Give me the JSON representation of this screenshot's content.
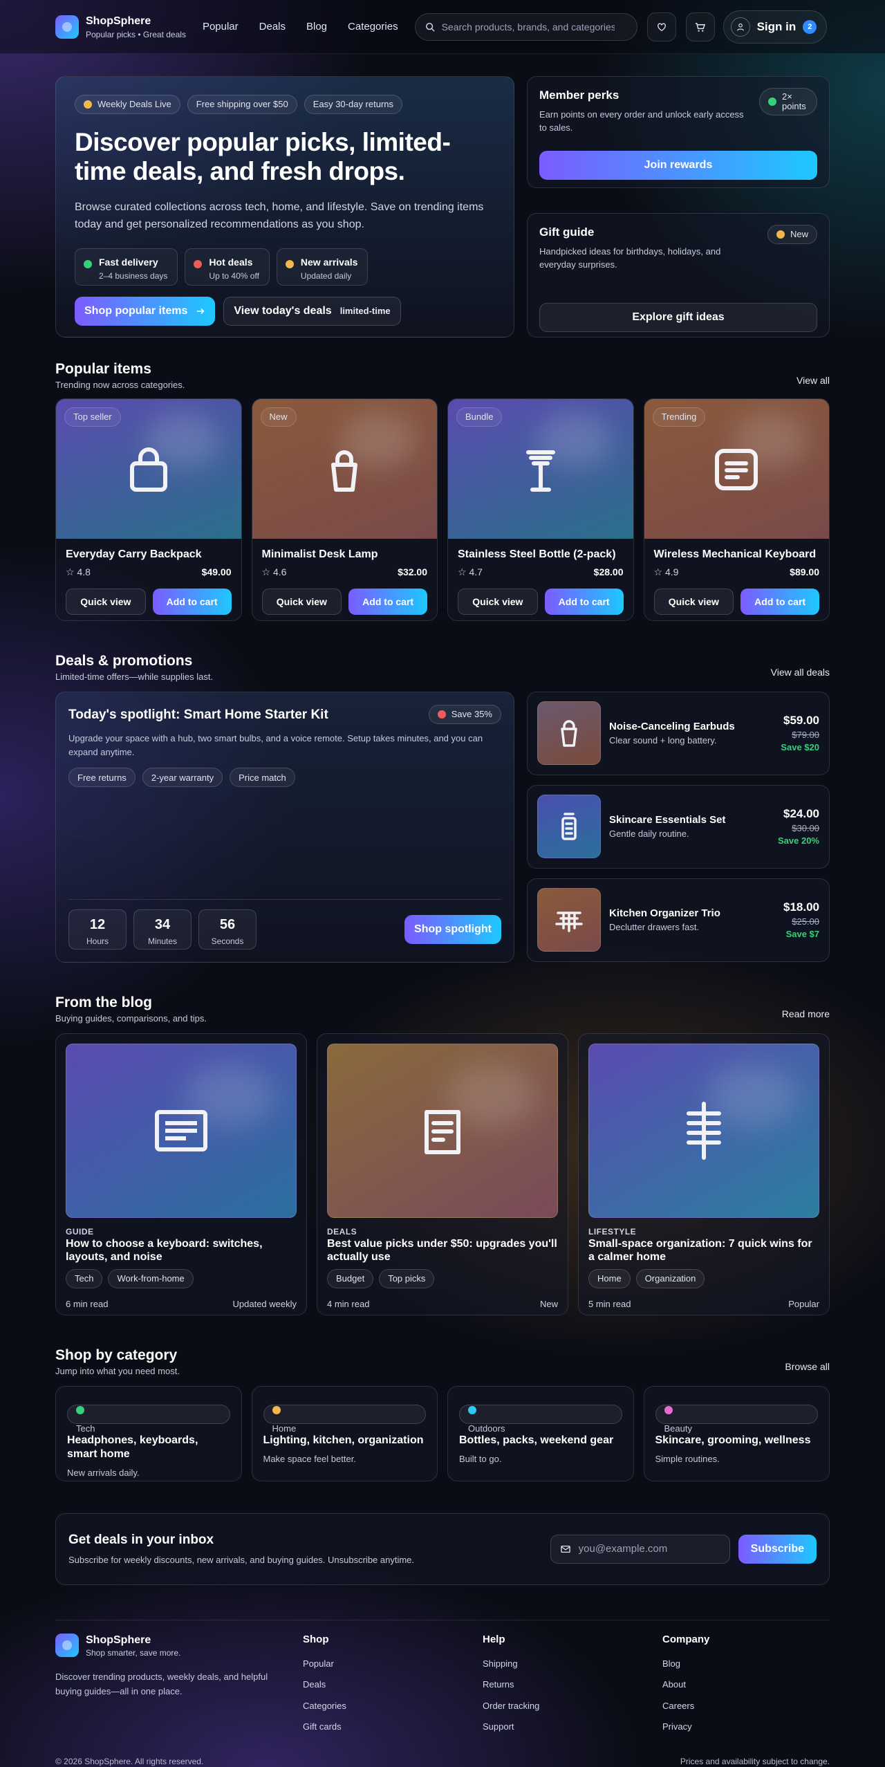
{
  "header": {
    "brand": "ShopSphere",
    "tagline": "Popular picks • Great deals",
    "nav": [
      "Popular",
      "Deals",
      "Blog",
      "Categories"
    ],
    "search_placeholder": "Search products, brands, and categories",
    "signin_label": "Sign in",
    "cart_count": "2"
  },
  "hero": {
    "pills": [
      "Weekly Deals Live",
      "Free shipping over $50",
      "Easy 30-day returns"
    ],
    "title": "Discover popular picks, limited-time deals, and fresh drops.",
    "text": "Browse curated collections across tech, home, and lifestyle. Save on trending items today and get personalized recommendations as you shop.",
    "features": [
      {
        "title": "Fast delivery",
        "sub": "2–4 business days",
        "color": "#34d17a"
      },
      {
        "title": "Hot deals",
        "sub": "Up to 40% off",
        "color": "#ef5b5b"
      },
      {
        "title": "New arrivals",
        "sub": "Updated daily",
        "color": "#f2b84b"
      }
    ],
    "cta_primary": "Shop popular items",
    "cta_secondary": "View today's deals",
    "cta_secondary_tag": "limited-time"
  },
  "perks": {
    "title": "Member perks",
    "text": "Earn points on every order and unlock early access to sales.",
    "badge": "2× points",
    "button": "Join rewards"
  },
  "gift": {
    "title": "Gift guide",
    "text": "Handpicked ideas for birthdays, holidays, and everyday surprises.",
    "badge": "New",
    "button": "Explore gift ideas"
  },
  "popular": {
    "title": "Popular items",
    "subtitle": "Trending now across categories.",
    "link": "View all",
    "quick_view": "Quick view",
    "add_to_cart": "Add to cart",
    "items": [
      {
        "badge": "Top seller",
        "name": "Everyday Carry Backpack",
        "rating": "4.8",
        "price": "$49.00",
        "icon": "bag-icon"
      },
      {
        "badge": "New",
        "name": "Minimalist Desk Lamp",
        "rating": "4.6",
        "price": "$32.00",
        "icon": "lamp-icon"
      },
      {
        "badge": "Bundle",
        "name": "Stainless Steel Bottle (2-pack)",
        "rating": "4.7",
        "price": "$28.00",
        "icon": "bottle-icon"
      },
      {
        "badge": "Trending",
        "name": "Wireless Mechanical Keyboard",
        "rating": "4.9",
        "price": "$89.00",
        "icon": "keyboard-icon"
      }
    ]
  },
  "deals": {
    "title": "Deals & promotions",
    "subtitle": "Limited-time offers—while supplies last.",
    "link": "View all deals",
    "spotlight": {
      "title": "Today's spotlight: Smart Home Starter Kit",
      "badge": "Save 35%",
      "text": "Upgrade your space with a hub, two smart bulbs, and a voice remote. Setup takes minutes, and you can expand anytime.",
      "tags": [
        "Free returns",
        "2-year warranty",
        "Price match"
      ],
      "countdown": [
        {
          "value": "12",
          "label": "Hours"
        },
        {
          "value": "34",
          "label": "Minutes"
        },
        {
          "value": "56",
          "label": "Seconds"
        }
      ],
      "button": "Shop spotlight"
    },
    "items": [
      {
        "name": "Noise-Canceling Earbuds",
        "sub": "Clear sound + long battery.",
        "price": "$59.00",
        "old": "$79.00",
        "save": "Save $20",
        "icon": "earbuds-icon"
      },
      {
        "name": "Skincare Essentials Set",
        "sub": "Gentle daily routine.",
        "price": "$24.00",
        "old": "$30.00",
        "save": "Save 20%",
        "icon": "skincare-icon"
      },
      {
        "name": "Kitchen Organizer Trio",
        "sub": "Declutter drawers fast.",
        "price": "$18.00",
        "old": "$25.00",
        "save": "Save $7",
        "icon": "organizer-icon"
      }
    ]
  },
  "blog": {
    "title": "From the blog",
    "subtitle": "Buying guides, comparisons, and tips.",
    "link": "Read more",
    "posts": [
      {
        "category": "GUIDE",
        "title": "How to choose a keyboard: switches, layouts, and noise",
        "tags": [
          "Tech",
          "Work-from-home"
        ],
        "read": "6 min read",
        "note": "Updated weekly",
        "icon": "keyboard-icon"
      },
      {
        "category": "DEALS",
        "title": "Best value picks under $50: upgrades you'll actually use",
        "tags": [
          "Budget",
          "Top picks"
        ],
        "read": "4 min read",
        "note": "New",
        "icon": "tag-icon"
      },
      {
        "category": "LIFESTYLE",
        "title": "Small-space organization: 7 quick wins for a calmer home",
        "tags": [
          "Home",
          "Organization"
        ],
        "read": "5 min read",
        "note": "Popular",
        "icon": "shelf-icon"
      }
    ]
  },
  "categories": {
    "title": "Shop by category",
    "subtitle": "Jump into what you need most.",
    "link": "Browse all",
    "items": [
      {
        "tag": "Tech",
        "title": "Headphones, keyboards, smart home",
        "sub": "New arrivals daily.",
        "color": "#34d17a"
      },
      {
        "tag": "Home",
        "title": "Lighting, kitchen, organization",
        "sub": "Make space feel better.",
        "color": "#f2b84b"
      },
      {
        "tag": "Outdoors",
        "title": "Bottles, packs, weekend gear",
        "sub": "Built to go.",
        "color": "#2fc8f0"
      },
      {
        "tag": "Beauty",
        "title": "Skincare, grooming, wellness",
        "sub": "Simple routines.",
        "color": "#e86bd0"
      }
    ]
  },
  "newsletter": {
    "title": "Get deals in your inbox",
    "text": "Subscribe for weekly discounts, new arrivals, and buying guides. Unsubscribe anytime.",
    "placeholder": "you@example.com",
    "button": "Subscribe"
  },
  "footer": {
    "brand": "ShopSphere",
    "tagline": "Shop smarter, save more.",
    "about": "Discover trending products, weekly deals, and helpful buying guides—all in one place.",
    "columns": [
      {
        "title": "Shop",
        "links": [
          "Popular",
          "Deals",
          "Categories",
          "Gift cards"
        ]
      },
      {
        "title": "Help",
        "links": [
          "Shipping",
          "Returns",
          "Order tracking",
          "Support"
        ]
      },
      {
        "title": "Company",
        "links": [
          "Blog",
          "About",
          "Careers",
          "Privacy"
        ]
      }
    ],
    "copyright": "© 2026 ShopSphere. All rights reserved.",
    "disclaimer": "Prices and availability subject to change."
  },
  "colors": {
    "accent_start": "#7b5cff",
    "accent_end": "#1ec8ff",
    "save_green": "#34d17a",
    "weekly_dot": "#f2b84b",
    "save_badge_dot": "#ef5b5b",
    "perk_dot": "#34d17a"
  }
}
